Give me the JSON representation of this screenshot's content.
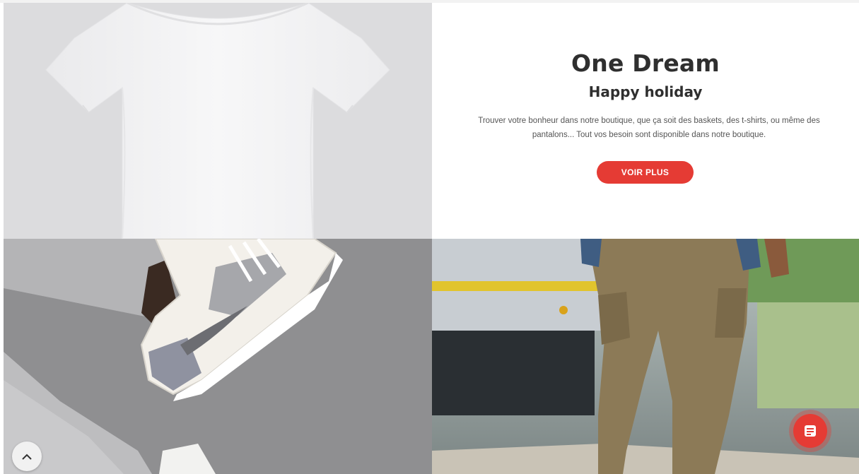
{
  "promo": {
    "title": "One Dream",
    "subtitle": "Happy holiday",
    "description": "Trouver votre bonheur dans notre boutique, que ça soit des baskets, des t-shirts, ou même des pantalons... Tout vos besoin sont disponible dans notre boutique.",
    "button_label": "VOIR PLUS"
  },
  "images": {
    "tshirt": "tshirt-image",
    "sneaker": "sneaker-image",
    "pants": "cargo-pants-image"
  },
  "controls": {
    "scroll_top_icon": "chevron-up-icon",
    "chat_icon": "chat-message-icon"
  },
  "colors": {
    "accent": "#e53b34",
    "heading": "#2f2f2f",
    "body_text": "#555555",
    "tshirt_background": "#dcdcde"
  }
}
